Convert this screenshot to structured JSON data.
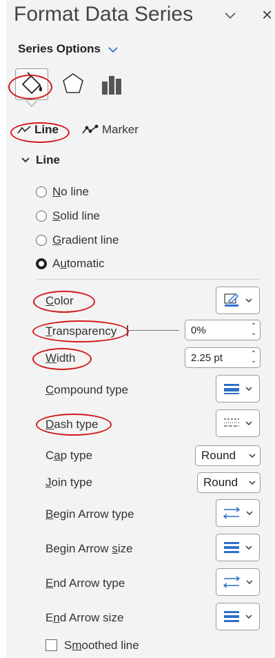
{
  "header": {
    "title": "Format Data Series",
    "close_glyph": "×"
  },
  "series_options": {
    "label": "Series Options"
  },
  "tabs": [
    {
      "icon": "paint-bucket-icon"
    },
    {
      "icon": "pentagon-icon"
    },
    {
      "icon": "bar-chart-icon"
    }
  ],
  "subtabs": {
    "line": "Line",
    "marker": "Marker"
  },
  "section": {
    "label": "Line"
  },
  "radios": [
    {
      "access": "N",
      "rest": "o line",
      "checked": false
    },
    {
      "access": "S",
      "rest": "olid line",
      "checked": false
    },
    {
      "access": "G",
      "rest": "radient line",
      "checked": false
    },
    {
      "prefix": "A",
      "access": "u",
      "rest": "tomatic",
      "checked": true
    }
  ],
  "props": {
    "color": {
      "access": "C",
      "rest": "olor"
    },
    "transparency": {
      "access": "T",
      "rest": "ransparency",
      "value": "0%",
      "level_percent": 0
    },
    "width": {
      "access": "W",
      "rest": "idth",
      "value": "2.25 pt"
    },
    "compound": {
      "access": "C",
      "rest": "ompound type"
    },
    "dash": {
      "access": "D",
      "rest": "ash type"
    },
    "cap": {
      "prefix": "C",
      "access": "a",
      "rest": "p type",
      "value": "Round"
    },
    "join": {
      "access": "J",
      "rest": "oin type",
      "value": "Round"
    },
    "begin_arrow_type": {
      "access": "B",
      "rest": "egin Arrow type"
    },
    "begin_arrow_size": {
      "prefix": "Begin Arrow ",
      "access": "s",
      "rest": "ize"
    },
    "end_arrow_type": {
      "access": "E",
      "rest": "nd Arrow type"
    },
    "end_arrow_size": {
      "prefix": "E",
      "access": "n",
      "rest": "d Arrow size"
    },
    "smoothed": {
      "prefix": "S",
      "access": "m",
      "rest": "oothed line",
      "checked": false
    }
  },
  "colors": {
    "annotation": "#d11a1a",
    "accent_blue": "#2f6fc9",
    "pane_bg": "#f3f3f3"
  }
}
